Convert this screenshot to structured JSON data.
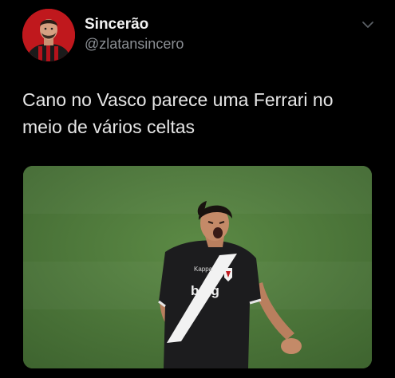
{
  "tweet": {
    "author": {
      "display_name": "Sincerão",
      "handle": "@zlatansincero",
      "avatar_icon": "avatar-photo"
    },
    "menu_icon": "chevron-down-icon",
    "text_lines": [
      "Cano no Vasco parece uma Ferrari no",
      "meio de vários celtas"
    ],
    "media": {
      "kind": "photo",
      "jersey_sponsor": "bmg",
      "jersey_brand": "Kappa",
      "pitch_color": "#4f7a3c",
      "jersey_color": "#1c1c1e"
    }
  },
  "colors": {
    "background": "#000000",
    "name": "#f2f2f2",
    "handle": "#8b8f94",
    "text": "#e6e6e6"
  }
}
